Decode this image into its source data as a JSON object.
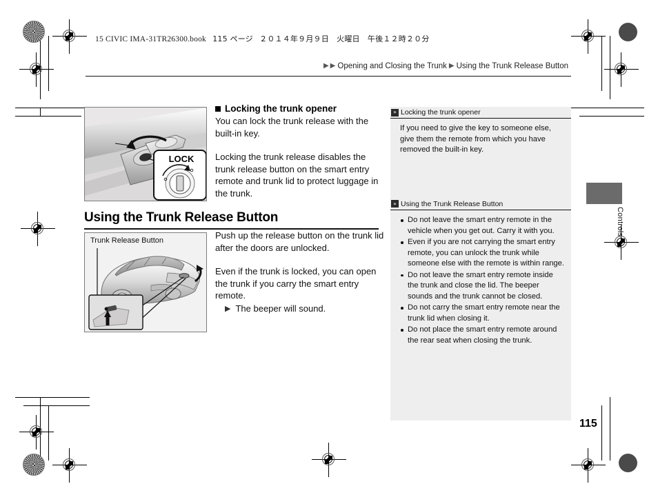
{
  "print_header": {
    "book_line_latin": "15 CIVIC IMA-31TR26300.book",
    "book_line_page": "115 ページ",
    "book_line_date": "２０１４年９月９日　火曜日　午後１２時２０分"
  },
  "breadcrumb": {
    "arrow_double_1": "▶",
    "arrow_double_2": "▶",
    "item1": "Opening and Closing the Trunk",
    "arrow_mid": "▶",
    "item2": "Using the Trunk Release Button"
  },
  "left_column": {
    "figure_lock": {
      "name": "trunk-lock-cylinder-illustration",
      "callout_label": "LOCK"
    },
    "figure_release": {
      "name": "trunk-release-button-illustration",
      "label": "Trunk Release Button"
    }
  },
  "main": {
    "subsection": {
      "heading": "Locking the trunk opener",
      "paragraph1": "You can lock the trunk release with the built-in key.",
      "paragraph2": "Locking the trunk release disables the trunk release button on the smart entry remote and trunk lid to protect luggage in the trunk."
    },
    "section": {
      "heading": "Using the Trunk Release Button",
      "paragraph1": "Push up the release button on the trunk lid after the doors are unlocked.",
      "paragraph2": "Even if the trunk is locked, you can open the trunk if you carry the smart entry remote.",
      "bullet_arrow": "▶",
      "bullet_text": "The beeper will sound."
    }
  },
  "sidebar": {
    "marker_glyph": "»",
    "section1": {
      "title": "Locking the trunk opener",
      "text": "If you need to give the key to someone else, give them the remote from which you have removed the built-in key."
    },
    "section2": {
      "title": "Using the Trunk Release Button",
      "bullets": [
        "Do not leave the smart entry remote in the vehicle when you get out. Carry it with you.",
        "Even if you are not carrying the smart entry remote, you can unlock the trunk while someone else with the remote is within range.",
        "Do not leave the smart entry remote inside the trunk and close the lid. The beeper sounds and the trunk cannot be closed.",
        "Do not carry the smart entry remote near the trunk lid when closing it.",
        "Do not place the smart entry remote around the rear seat when closing the trunk."
      ]
    }
  },
  "thumb_tab": {
    "label": "Controls",
    "color": "#6b6b6b"
  },
  "page_number": "115",
  "colors": {
    "sidebar_bg": "#eeeeee",
    "rule": "#111111",
    "figure_border": "#7d7d7d"
  }
}
